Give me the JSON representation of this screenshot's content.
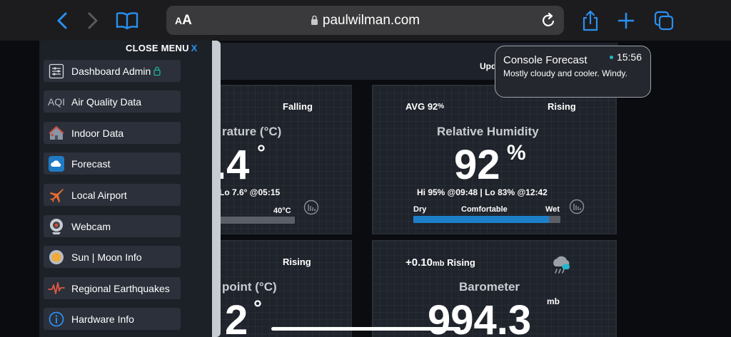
{
  "browser": {
    "aa_label_a": "A",
    "aa_label_b": "A",
    "url": "paulwilman.com"
  },
  "menu": {
    "close_label": "CLOSE MENU",
    "close_x": "X",
    "items": [
      {
        "label": "Dashboard Admin",
        "icon": "sliders-icon"
      },
      {
        "label": "Air Quality Data",
        "icon": "aqi-icon",
        "icon_text": "AQI"
      },
      {
        "label": "Indoor Data",
        "icon": "house-icon"
      },
      {
        "label": "Forecast",
        "icon": "cloud-icon"
      },
      {
        "label": "Local Airport",
        "icon": "airplane-icon"
      },
      {
        "label": "Webcam",
        "icon": "webcam-icon"
      },
      {
        "label": "Sun | Moon Info",
        "icon": "sun-icon"
      },
      {
        "label": "Regional Earthquakes",
        "icon": "earthquake-icon"
      },
      {
        "label": "Hardware Info",
        "icon": "info-icon"
      }
    ]
  },
  "header": {
    "updated_partial": "Upd"
  },
  "cards": {
    "temperature": {
      "trend": "Falling",
      "title_partial": "rature (°C)",
      "value_partial": ".4",
      "unit": "°",
      "hilo_partial": "Lo 7.6° @05:15",
      "bar_max": "40°C"
    },
    "humidity": {
      "avg": "AVG 92",
      "avg_unit": "%",
      "trend": "Rising",
      "title": "Relative Humidity",
      "value": "92",
      "unit": "%",
      "hilo": "Hi 95% @09:48 | Lo 83% @12:42",
      "bar_left": "Dry",
      "bar_mid": "Comfortable",
      "bar_right": "Wet",
      "bar_level": 0.92
    },
    "dewpoint": {
      "trend": "Rising",
      "title_partial": "point (°C)",
      "value_partial": "2",
      "unit": "°"
    },
    "barometer": {
      "trend_value": "+0.10",
      "trend_unit": "mb",
      "trend": "Rising",
      "title": "Barometer",
      "value": "994.3",
      "unit": "mb"
    }
  },
  "popup": {
    "title": "Console Forecast",
    "time": "15:56",
    "body": "Mostly cloudy and cooler. Windy."
  },
  "colors": {
    "accent_blue": "#2a8ff0",
    "bar_blue": "#1e7fc9",
    "teal_dot": "#25b5c9"
  }
}
